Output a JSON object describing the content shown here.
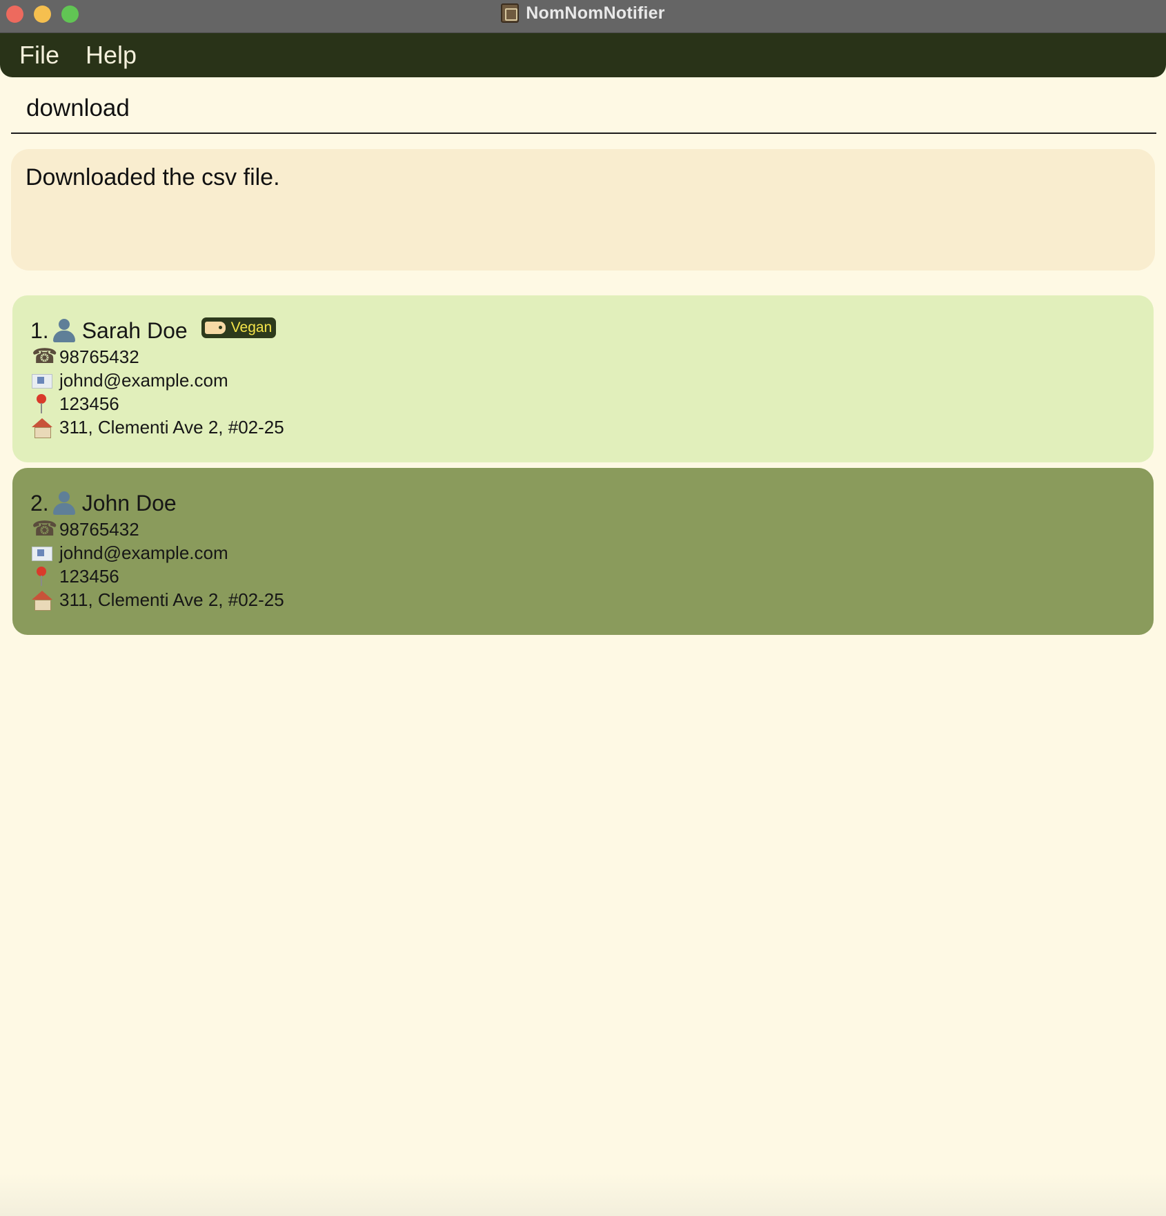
{
  "window": {
    "title": "NomNomNotifier",
    "app_icon": "notebook-icon"
  },
  "menu": {
    "items": [
      {
        "label": "File"
      },
      {
        "label": "Help"
      }
    ]
  },
  "command": {
    "value": "download"
  },
  "result": {
    "message": "Downloaded the csv file."
  },
  "persons": [
    {
      "index": "1.",
      "name": "Sarah Doe",
      "tag": "Vegan",
      "phone": "98765432",
      "email": "johnd@example.com",
      "postal": "123456",
      "address": "311, Clementi Ave 2, #02-25",
      "background": "#e1efbb"
    },
    {
      "index": "2.",
      "name": "John Doe",
      "phone": "98765432",
      "email": "johnd@example.com",
      "postal": "123456",
      "address": "311, Clementi Ave 2, #02-25",
      "background": "#8a9b5c"
    }
  ],
  "colors": {
    "titlebar": "#656565",
    "menubar": "#293318",
    "app_background": "#fef9e4",
    "result_background": "#f9edcf",
    "selected_card": "#8a9b5c",
    "card": "#e1efbb",
    "tag_background": "#2d3a1c",
    "tag_text": "#f5e54a"
  }
}
